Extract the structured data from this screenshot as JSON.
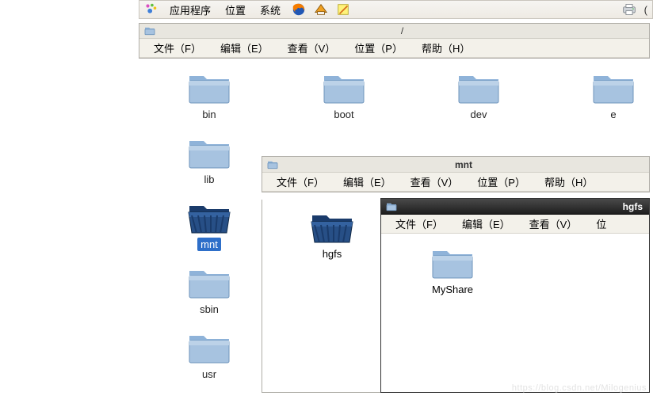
{
  "panel": {
    "menu_apps": "应用程序",
    "menu_places": "位置",
    "menu_system": "系统"
  },
  "root_window": {
    "title": "/",
    "menus": {
      "file": "文件（F）",
      "edit": "编辑（E）",
      "view": "查看（V）",
      "places": "位置（P）",
      "help": "帮助（H）"
    },
    "folders": [
      "bin",
      "boot",
      "dev",
      "e",
      "lib",
      "",
      "",
      "",
      "mnt",
      "",
      "",
      "",
      "sbin",
      "",
      "",
      "",
      "usr",
      "",
      "",
      ""
    ],
    "selected": "mnt"
  },
  "mnt_window": {
    "title": "mnt",
    "menus": {
      "file": "文件（F）",
      "edit": "编辑（E）",
      "view": "查看（V）",
      "places": "位置（P）",
      "help": "帮助（H）"
    },
    "folders": [
      "hgfs"
    ],
    "selected": "hgfs"
  },
  "hgfs_window": {
    "title": "hgfs",
    "menus": {
      "file": "文件（F）",
      "edit": "编辑（E）",
      "view": "查看（V）",
      "places": "位"
    },
    "folders": [
      "MyShare"
    ]
  },
  "watermark": "https://blog.csdn.net/Milogenius"
}
